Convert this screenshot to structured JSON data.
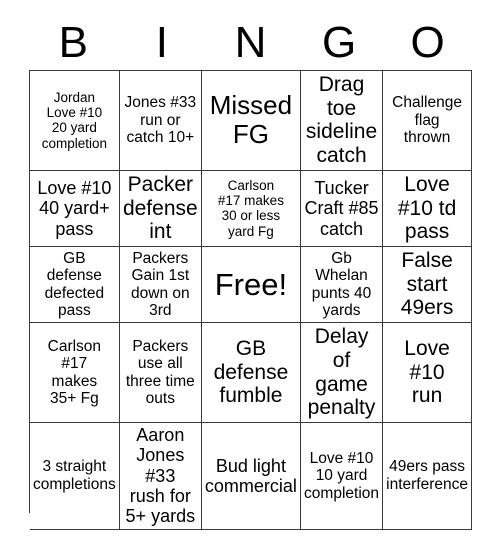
{
  "header": {
    "letters": [
      "B",
      "I",
      "N",
      "G",
      "O"
    ]
  },
  "grid": {
    "rows": 5,
    "columns": 5,
    "border_color": "#3a3a3a",
    "background": "#ffffff",
    "text_color": "#000000",
    "cells": [
      {
        "text": "Jordan\nLove #10\n20 yard\ncompletion",
        "size": "xs"
      },
      {
        "text": "Jones #33\nrun or\ncatch 10+",
        "size": "s"
      },
      {
        "text": "Missed\nFG",
        "size": "xl"
      },
      {
        "text": "Drag toe\nsideline\ncatch",
        "size": "l"
      },
      {
        "text": "Challenge\nflag\nthrown",
        "size": "s"
      },
      {
        "text": "Love #10\n40 yard+\npass",
        "size": "m"
      },
      {
        "text": "Packer\ndefense\nint",
        "size": "l"
      },
      {
        "text": "Carlson\n#17 makes\n30 or less\nyard Fg",
        "size": "xs"
      },
      {
        "text": "Tucker\nCraft #85\ncatch",
        "size": "m"
      },
      {
        "text": "Love\n#10 td\npass",
        "size": "l"
      },
      {
        "text": "GB\ndefense\ndefected\npass",
        "size": "s"
      },
      {
        "text": "Packers\nGain 1st\ndown on\n3rd",
        "size": "s"
      },
      {
        "text": "Free!",
        "size": "free"
      },
      {
        "text": "Gb\nWhelan\npunts 40\nyards",
        "size": "s"
      },
      {
        "text": "False\nstart\n49ers",
        "size": "l"
      },
      {
        "text": "Carlson\n#17\nmakes\n35+ Fg",
        "size": "s"
      },
      {
        "text": "Packers\nuse all\nthree time\nouts",
        "size": "s"
      },
      {
        "text": "GB\ndefense\nfumble",
        "size": "l"
      },
      {
        "text": "Delay\nof game\npenalty",
        "size": "l"
      },
      {
        "text": "Love\n#10\nrun",
        "size": "l"
      },
      {
        "text": "3 straight\ncompletions",
        "size": "s"
      },
      {
        "text": "Aaron\nJones #33\nrush for\n5+ yards",
        "size": "m"
      },
      {
        "text": "Bud light\ncommercial",
        "size": "m"
      },
      {
        "text": "Love #10\n10 yard\ncompletion",
        "size": "s"
      },
      {
        "text": "49ers pass\ninterference",
        "size": "s"
      }
    ]
  }
}
